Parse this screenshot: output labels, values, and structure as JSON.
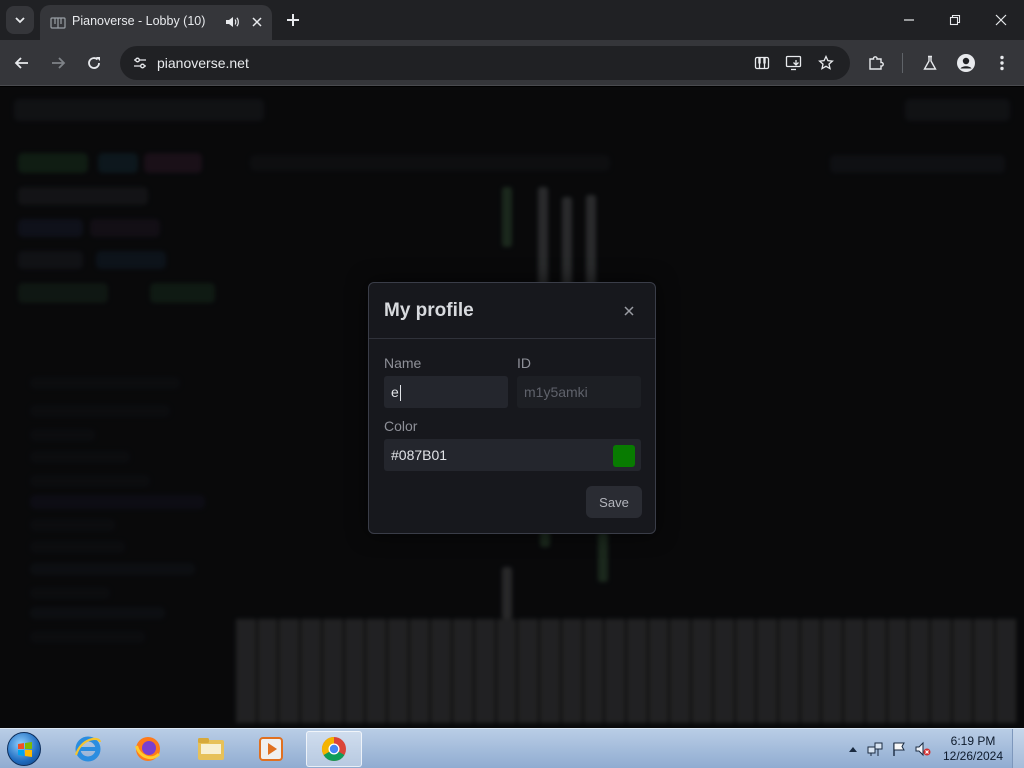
{
  "browser": {
    "tab": {
      "title": "Pianoverse - Lobby (10)"
    },
    "address": {
      "url": "pianoverse.net"
    }
  },
  "modal": {
    "title": "My profile",
    "name_label": "Name",
    "name_value": "e",
    "id_label": "ID",
    "id_value": "m1y5amki",
    "color_label": "Color",
    "color_value": "#087B01",
    "swatch_color": "#087B01",
    "save_label": "Save"
  },
  "taskbar": {
    "apps": [
      "internet-explorer",
      "firefox",
      "file-explorer",
      "media-player",
      "chrome"
    ],
    "clock": {
      "time": "6:19 PM",
      "date": "12/26/2024"
    }
  },
  "colors": {
    "chrome_dark": "#202124",
    "chrome_toolbar": "#35363a",
    "modal_bg": "#17181d",
    "accent_green": "#087B01"
  }
}
